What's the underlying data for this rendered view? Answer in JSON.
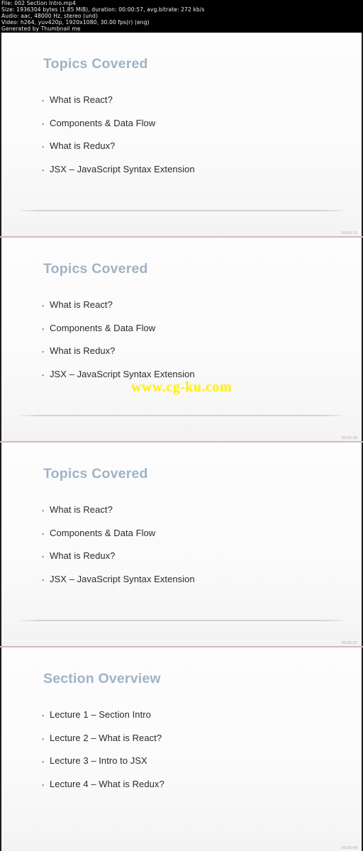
{
  "info_header": {
    "lines": [
      "File: 002 Section Intro.mp4",
      "Size: 1936304 bytes (1.85 MiB), duration: 00:00:57, avg.bitrate: 272 kb/s",
      "Audio: aac, 48000 Hz, stereo (und)",
      "Video: h264, yuv420p, 1920x1080, 30.00 fps(r) (eng)",
      "Generated by Thumbnail me"
    ]
  },
  "watermark": {
    "text": "www.cg-ku.com",
    "color": "#fff213"
  },
  "theme": {
    "title_color": "#9fb3c6",
    "body_color": "#2b2b2b",
    "separator_color": "#d5b8c1",
    "rule_color": "#cdd6d3",
    "bullet_marker": "▪"
  },
  "slides": [
    {
      "title": "Topics Covered",
      "bullets": [
        "What is React?",
        "Components & Data Flow",
        "What is Redux?",
        "JSX – JavaScript Syntax Extension"
      ],
      "timestamp": "00:00:15"
    },
    {
      "title": "Topics Covered",
      "bullets": [
        "What is React?",
        "Components & Data Flow",
        "What is Redux?",
        "JSX – JavaScript Syntax Extension"
      ],
      "timestamp": "00:00:28"
    },
    {
      "title": "Topics Covered",
      "bullets": [
        "What is React?",
        "Components & Data Flow",
        "What is Redux?",
        "JSX – JavaScript Syntax Extension"
      ],
      "timestamp": "00:00:37"
    },
    {
      "title": "Section Overview",
      "bullets": [
        "Lecture 1 – Section Intro",
        "Lecture 2 – What is React?",
        "Lecture 3 – Intro to JSX",
        "Lecture 4 – What is Redux?"
      ],
      "timestamp": "00:00:49"
    }
  ]
}
